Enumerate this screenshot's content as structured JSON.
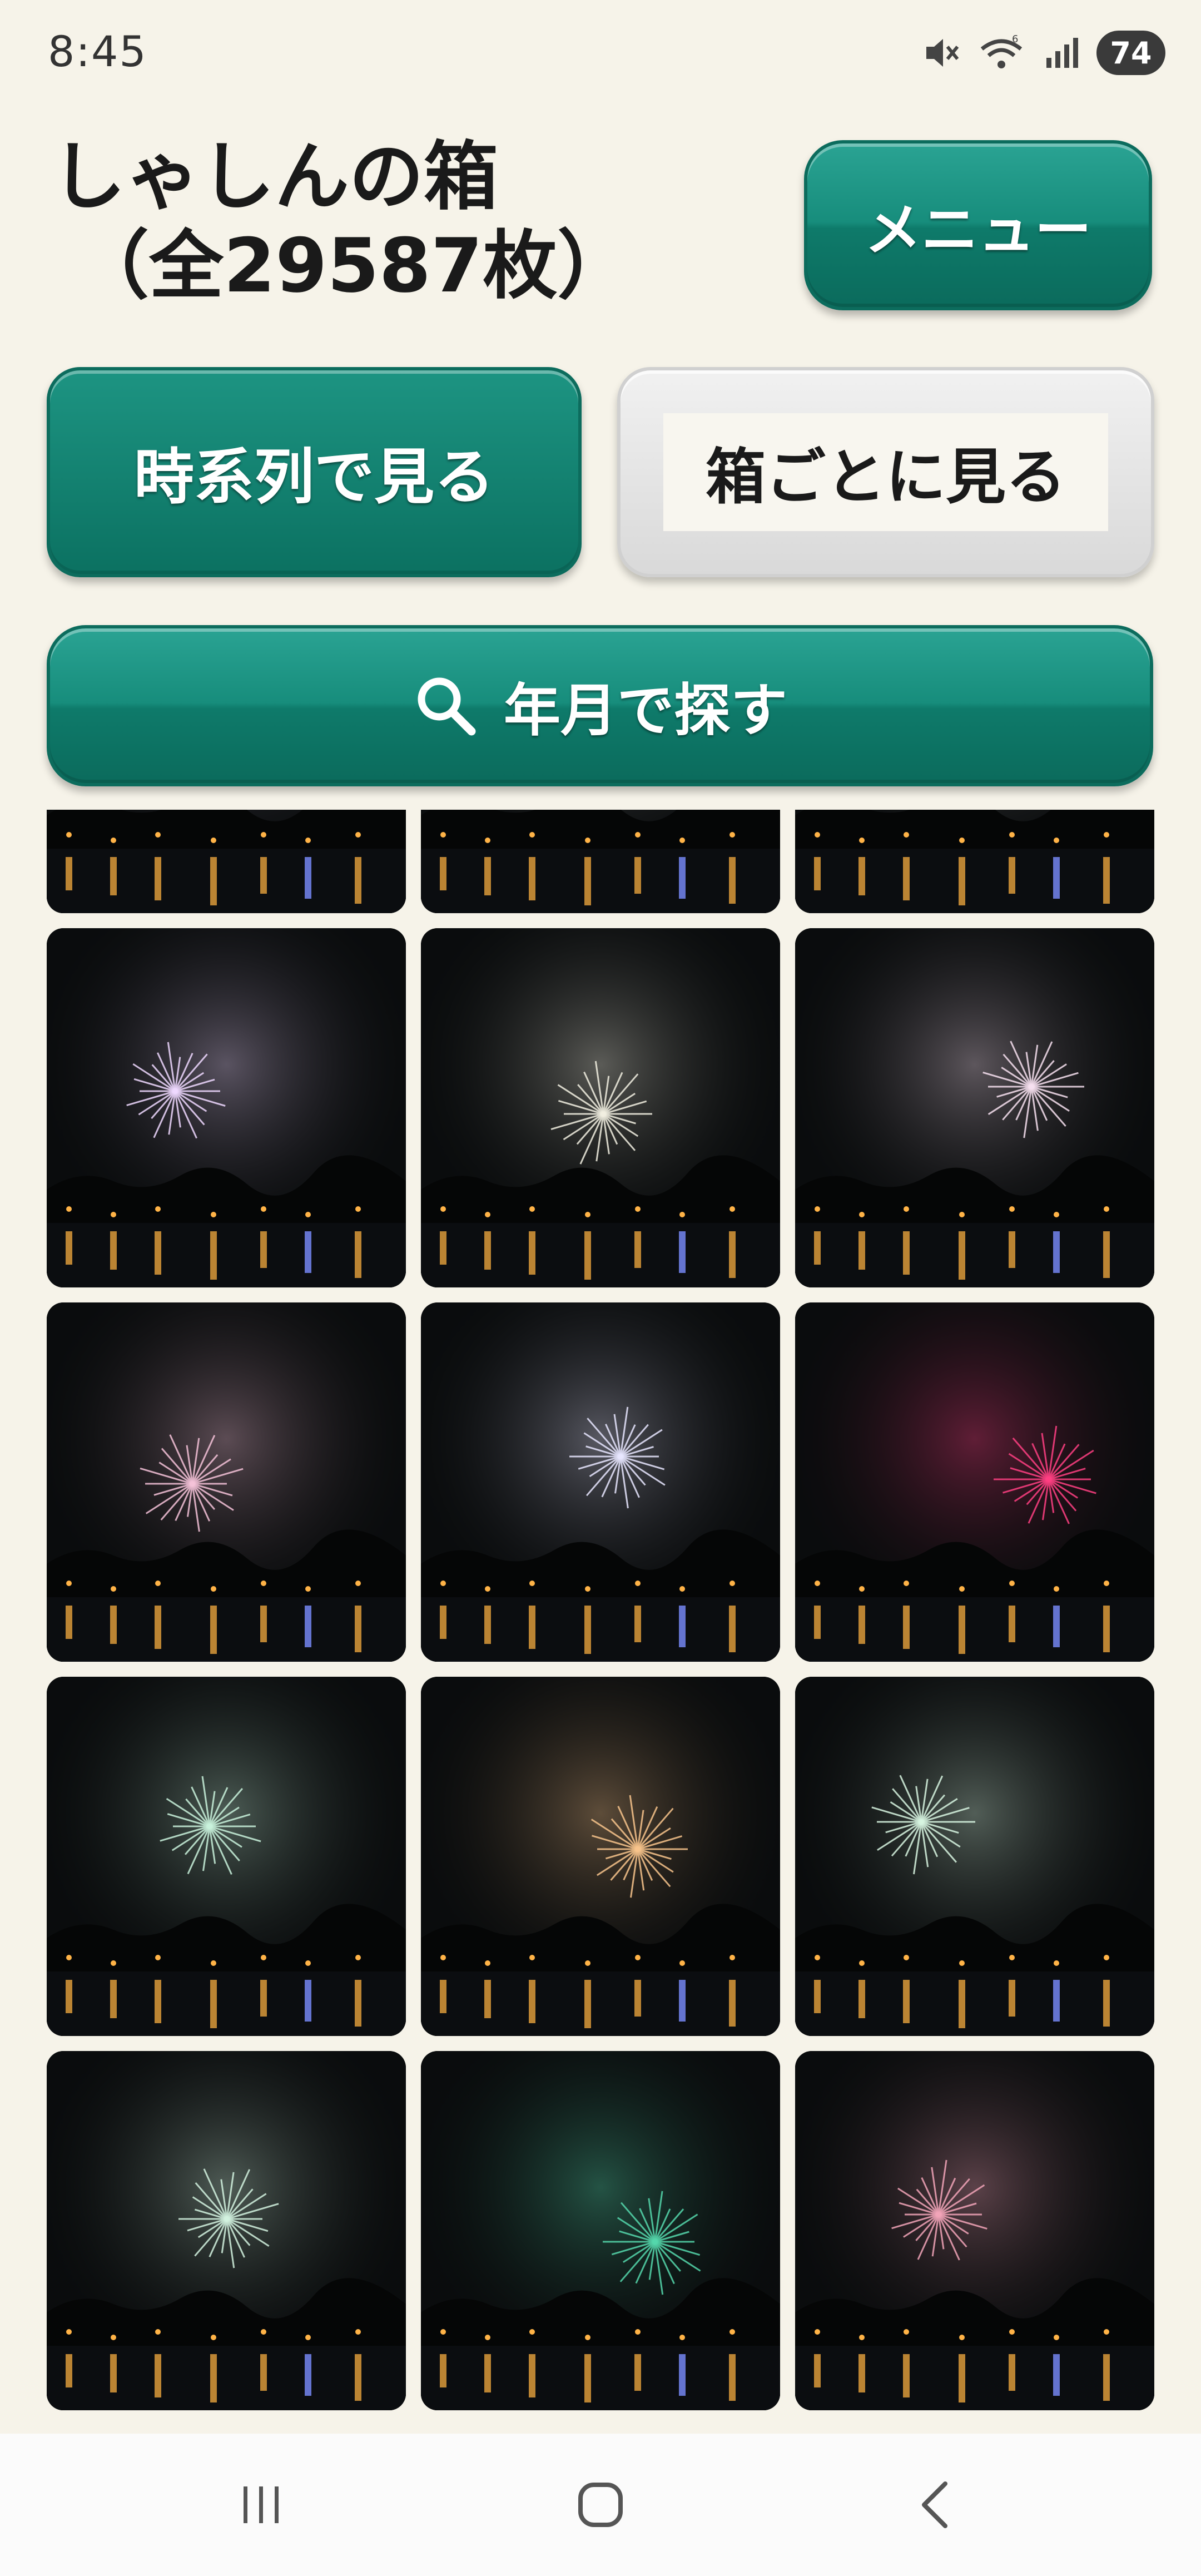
{
  "status_bar": {
    "time": "8:45",
    "battery": "74",
    "icons": [
      "mute-icon",
      "wifi-icon",
      "signal-icon",
      "battery-icon"
    ]
  },
  "header": {
    "title_line1": "しゃしんの箱",
    "title_line2": "（全29587枚）",
    "menu_label": "メニュー"
  },
  "view_buttons": {
    "chronological_label": "時系列で見る",
    "by_box_label": "箱ごとに見る"
  },
  "search": {
    "label": "年月で探す",
    "icon": "search-icon"
  },
  "colors": {
    "accent": "#178d7c",
    "background": "#f6f3e9"
  },
  "photo_grid": {
    "columns": 3,
    "photos": [
      {
        "subject": "fireworks",
        "color": "#d8c9f0"
      },
      {
        "subject": "fireworks",
        "color": "#ffffff"
      },
      {
        "subject": "fireworks",
        "color": "#ffffff"
      },
      {
        "subject": "fireworks",
        "color": "#efd8ff"
      },
      {
        "subject": "fireworks",
        "color": "#f1eee0"
      },
      {
        "subject": "fireworks",
        "color": "#f7e0f0"
      },
      {
        "subject": "fireworks",
        "color": "#f4c2d8"
      },
      {
        "subject": "fireworks",
        "color": "#e8e6ff"
      },
      {
        "subject": "fireworks",
        "color": "#ff3f83"
      },
      {
        "subject": "fireworks",
        "color": "#c9f2dc"
      },
      {
        "subject": "fireworks",
        "color": "#f8c48c"
      },
      {
        "subject": "fireworks",
        "color": "#d7f5e0"
      },
      {
        "subject": "fireworks",
        "color": "#d2f2df"
      },
      {
        "subject": "fireworks",
        "color": "#55d7ac"
      },
      {
        "subject": "fireworks",
        "color": "#f2a5b8"
      }
    ]
  },
  "nav_bar": {
    "items": [
      "recent-apps-icon",
      "home-icon",
      "back-icon"
    ]
  }
}
